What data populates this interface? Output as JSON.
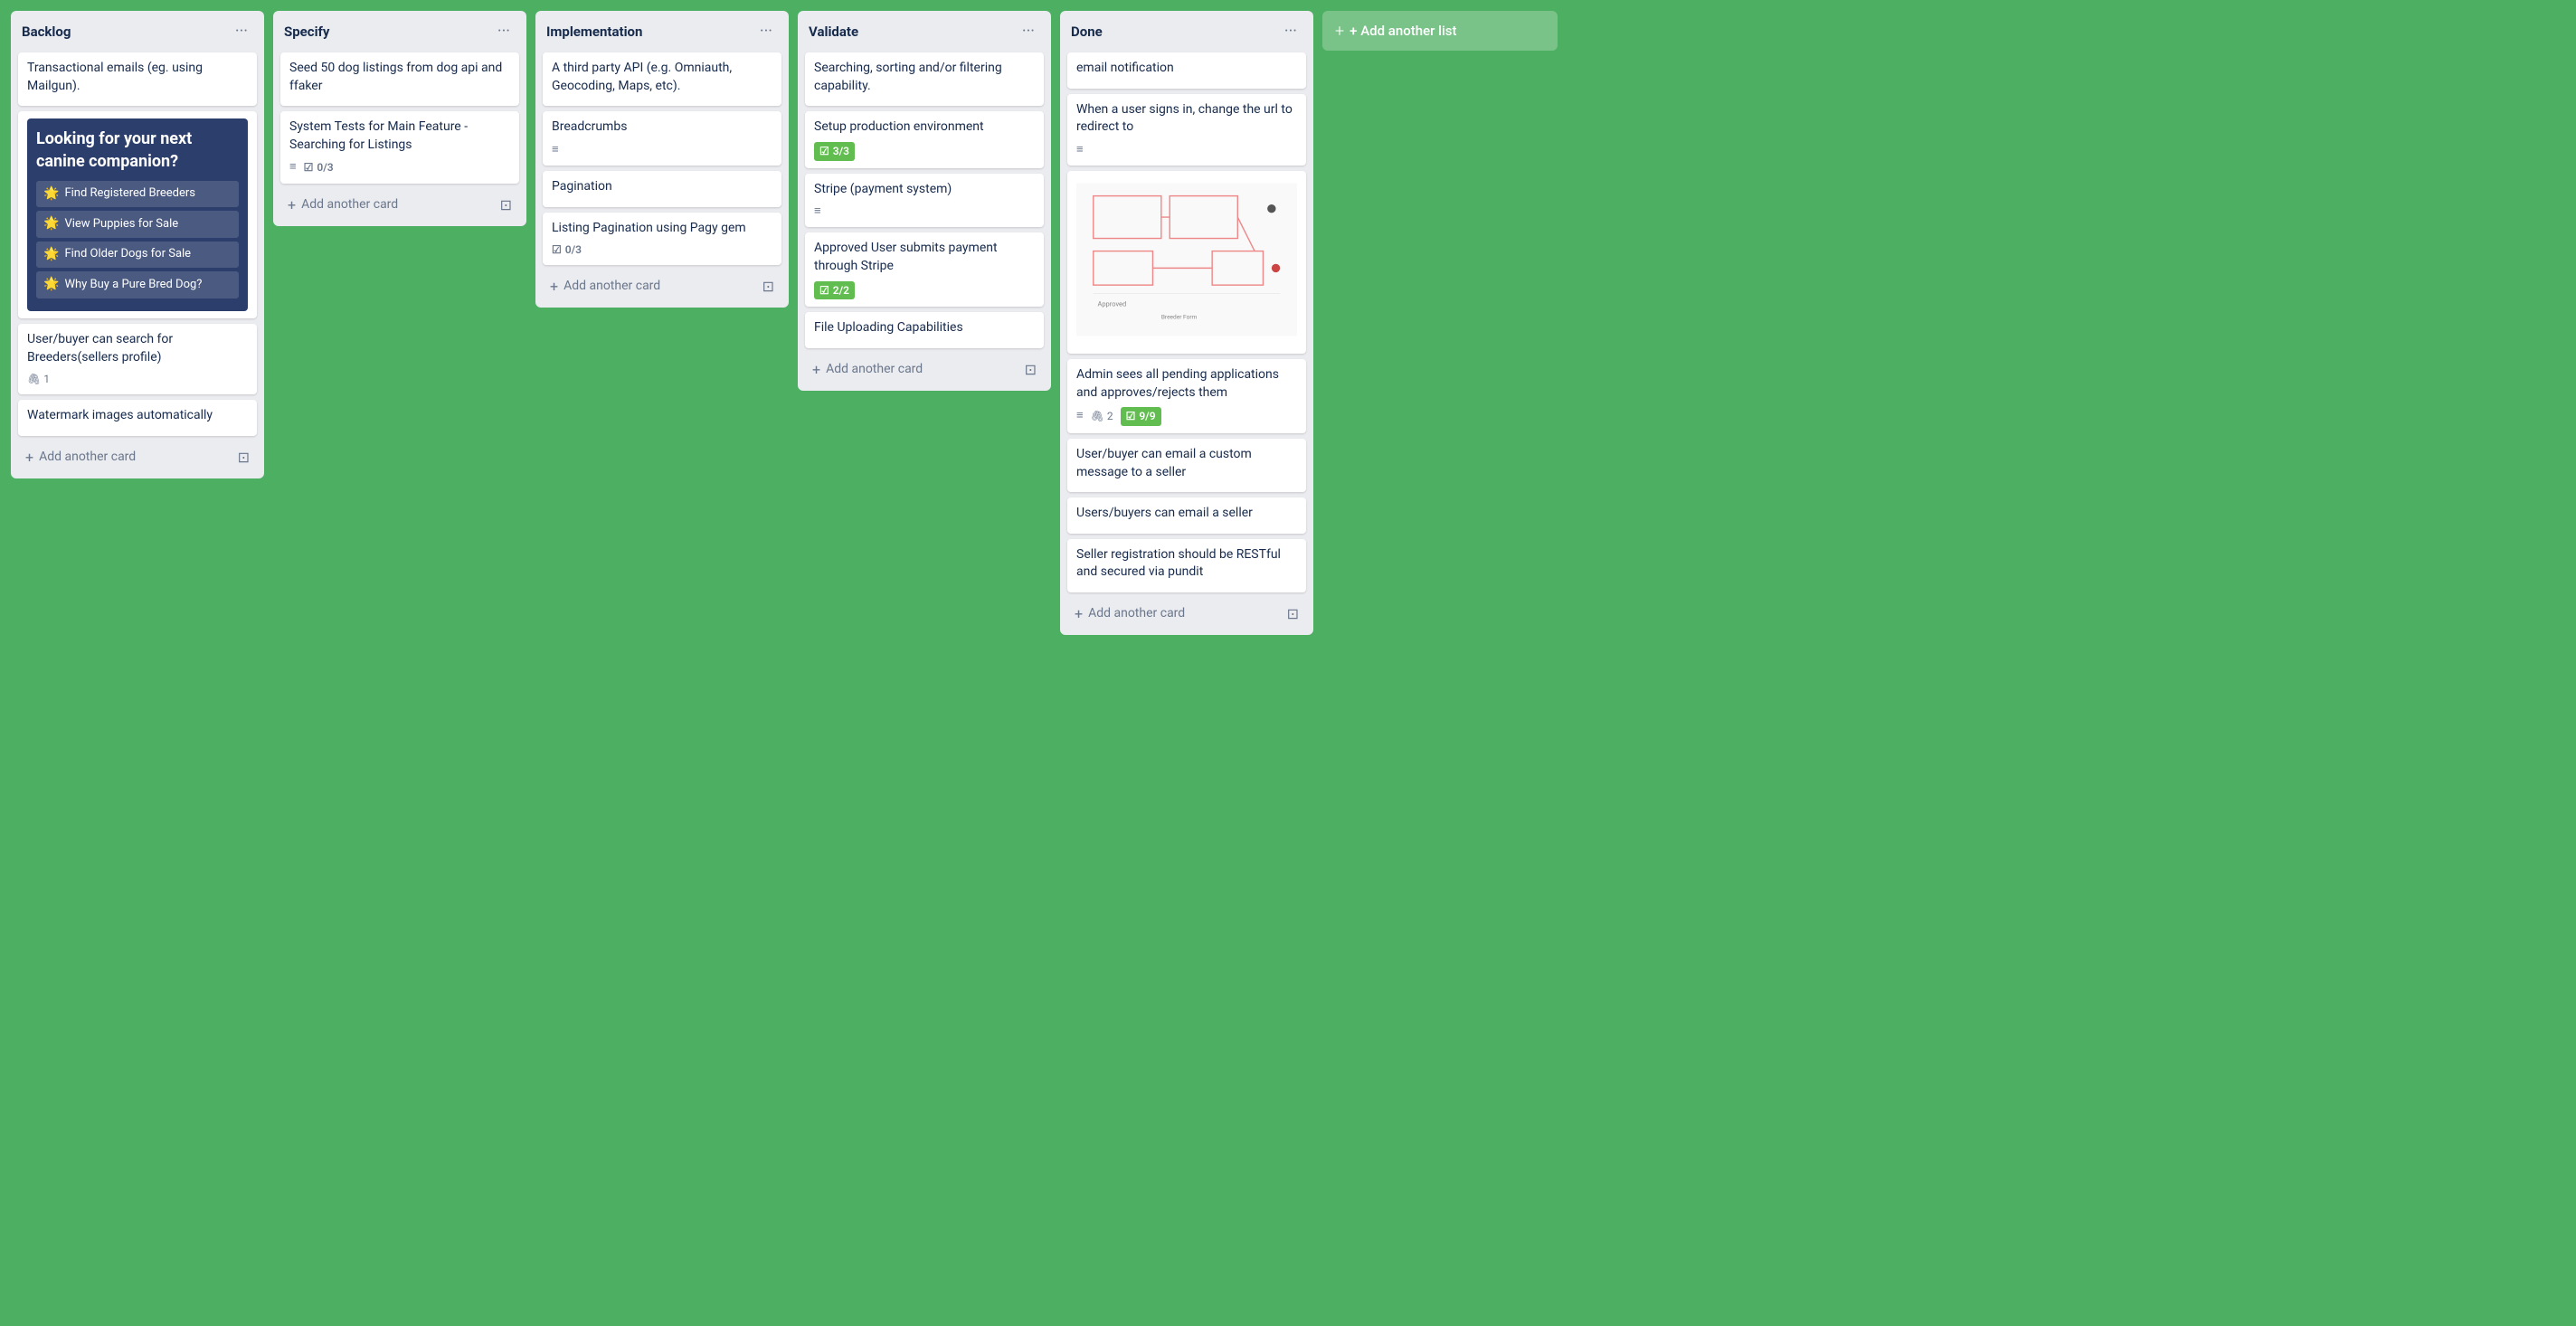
{
  "board": {
    "background_color": "#4caf62",
    "add_column_label": "+ Add another list"
  },
  "columns": [
    {
      "id": "backlog",
      "title": "Backlog",
      "cards": [
        {
          "id": "bl1",
          "text": "Transactional emails (eg. using Mailgun).",
          "meta": {}
        },
        {
          "id": "bl2",
          "type": "image-card",
          "image_type": "dog-ad",
          "ad_title": "Looking for your next canine companion?",
          "ad_links": [
            "Find Registered Breeders",
            "View Puppies for Sale",
            "Find Older Dogs for Sale",
            "Why Buy a Pure Bred Dog?"
          ]
        },
        {
          "id": "bl3",
          "text": "User/buyer can search for Breeders(sellers profile)",
          "meta": {
            "paperclip": true,
            "paperclip_count": "1"
          }
        },
        {
          "id": "bl4",
          "text": "Watermark images automatically",
          "meta": {}
        }
      ],
      "add_card_label": "Add another card"
    },
    {
      "id": "specify",
      "title": "Specify",
      "cards": [
        {
          "id": "sp1",
          "text": "Seed 50 dog listings from dog api and ffaker",
          "meta": {}
        },
        {
          "id": "sp2",
          "text": "System Tests for Main Feature - Searching for Listings",
          "meta": {
            "description": true,
            "checklist": true,
            "checklist_count": "0/3"
          }
        }
      ],
      "add_card_label": "Add another card"
    },
    {
      "id": "implementation",
      "title": "Implementation",
      "cards": [
        {
          "id": "im1",
          "text": "A third party API (e.g. Omniauth, Geocoding, Maps, etc).",
          "meta": {}
        },
        {
          "id": "im2",
          "text": "Breadcrumbs",
          "meta": {
            "description": true
          }
        },
        {
          "id": "im3",
          "text": "Pagination",
          "meta": {}
        },
        {
          "id": "im4",
          "text": "Listing Pagination using Pagy gem",
          "meta": {
            "checklist": true,
            "checklist_count": "0/3"
          }
        }
      ],
      "add_card_label": "Add another card"
    },
    {
      "id": "validate",
      "title": "Validate",
      "cards": [
        {
          "id": "va1",
          "text": "Searching, sorting and/or filtering capability.",
          "meta": {}
        },
        {
          "id": "va2",
          "text": "Setup production environment",
          "meta": {
            "badge_green": "3/3"
          }
        },
        {
          "id": "va3",
          "text": "Stripe (payment system)",
          "meta": {
            "description": true
          }
        },
        {
          "id": "va4",
          "text": "Approved User submits payment through Stripe",
          "meta": {
            "badge_green": "2/2"
          }
        },
        {
          "id": "va5",
          "text": "File Uploading Capabilities",
          "meta": {}
        }
      ],
      "add_card_label": "Add another card"
    },
    {
      "id": "done",
      "title": "Done",
      "cards": [
        {
          "id": "dn1",
          "text": "email notification",
          "meta": {}
        },
        {
          "id": "dn2",
          "text": "When a user signs in, change the url to redirect to",
          "meta": {
            "description": true
          }
        },
        {
          "id": "dn3",
          "type": "sketch-card",
          "text": "",
          "meta": {}
        },
        {
          "id": "dn4",
          "text": "Admin sees all pending applications and approves/rejects them",
          "meta": {
            "description": true,
            "paperclip": true,
            "paperclip_count": "2",
            "badge_green": "9/9"
          }
        },
        {
          "id": "dn5",
          "text": "User/buyer can email a custom message to a seller",
          "meta": {}
        },
        {
          "id": "dn6",
          "text": "Users/buyers can email a seller",
          "meta": {}
        },
        {
          "id": "dn7",
          "text": "Seller registration should be RESTful and secured via pundit",
          "meta": {}
        }
      ],
      "add_card_label": "Add another card"
    }
  ]
}
